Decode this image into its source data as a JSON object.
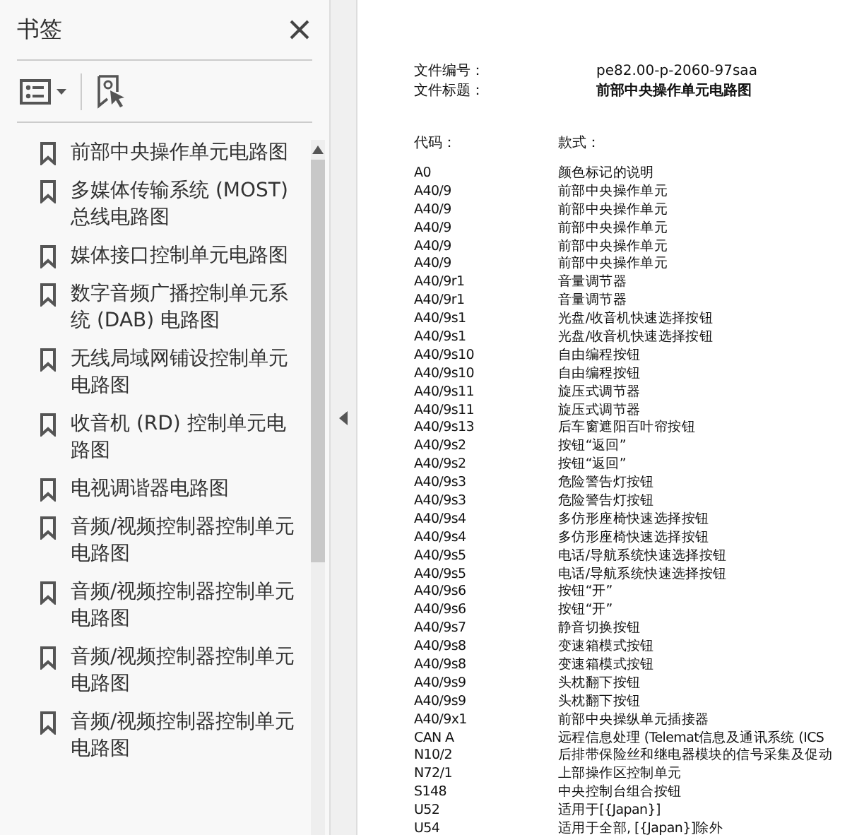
{
  "sidebar": {
    "title": "书签",
    "bookmarks": [
      {
        "label": "前部中央操作单元电路图"
      },
      {
        "label": "多媒体传输系统 (MOST) 总线电路图"
      },
      {
        "label": "媒体接口控制单元电路图"
      },
      {
        "label": "数字音频广播控制单元系统 (DAB) 电路图"
      },
      {
        "label": "无线局域网铺设控制单元电路图"
      },
      {
        "label": "收音机 (RD) 控制单元电路图"
      },
      {
        "label": "电视调谐器电路图"
      },
      {
        "label": "音频/视频控制器控制单元电路图"
      },
      {
        "label": "音频/视频控制器控制单元电路图"
      },
      {
        "label": "音频/视频控制器控制单元电路图"
      },
      {
        "label": "音频/视频控制器控制单元电路图"
      }
    ]
  },
  "document": {
    "meta": [
      {
        "label": "文件编号：",
        "value": "pe82.00-p-2060-97saa"
      },
      {
        "label": "文件标题：",
        "value": "前部中央操作单元电路图"
      }
    ],
    "columns": [
      "代码：",
      "款式："
    ],
    "rows": [
      {
        "code": "A0",
        "description": "颜色标记的说明"
      },
      {
        "code": "A40/9",
        "description": "前部中央操作单元"
      },
      {
        "code": "A40/9",
        "description": "前部中央操作单元"
      },
      {
        "code": "A40/9",
        "description": "前部中央操作单元"
      },
      {
        "code": "A40/9",
        "description": "前部中央操作单元"
      },
      {
        "code": "A40/9",
        "description": "前部中央操作单元"
      },
      {
        "code": "A40/9r1",
        "description": "音量调节器"
      },
      {
        "code": "A40/9r1",
        "description": "音量调节器"
      },
      {
        "code": "A40/9s1",
        "description": "光盘/收音机快速选择按钮"
      },
      {
        "code": "A40/9s1",
        "description": "光盘/收音机快速选择按钮"
      },
      {
        "code": "A40/9s10",
        "description": "自由编程按钮"
      },
      {
        "code": "A40/9s10",
        "description": "自由编程按钮"
      },
      {
        "code": "A40/9s11",
        "description": "旋压式调节器"
      },
      {
        "code": "A40/9s11",
        "description": "旋压式调节器"
      },
      {
        "code": "A40/9s13",
        "description": "后车窗遮阳百叶帘按钮"
      },
      {
        "code": "A40/9s2",
        "description": "按钮“返回”"
      },
      {
        "code": "A40/9s2",
        "description": "按钮“返回”"
      },
      {
        "code": "A40/9s3",
        "description": "危险警告灯按钮"
      },
      {
        "code": "A40/9s3",
        "description": "危险警告灯按钮"
      },
      {
        "code": "A40/9s4",
        "description": "多仿形座椅快速选择按钮"
      },
      {
        "code": "A40/9s4",
        "description": "多仿形座椅快速选择按钮"
      },
      {
        "code": "A40/9s5",
        "description": "电话/导航系统快速选择按钮"
      },
      {
        "code": "A40/9s5",
        "description": "电话/导航系统快速选择按钮"
      },
      {
        "code": "A40/9s6",
        "description": "按钮“开”"
      },
      {
        "code": "A40/9s6",
        "description": "按钮“开”"
      },
      {
        "code": "A40/9s7",
        "description": "静音切换按钮"
      },
      {
        "code": "A40/9s8",
        "description": "变速箱模式按钮"
      },
      {
        "code": "A40/9s8",
        "description": "变速箱模式按钮"
      },
      {
        "code": "A40/9s9",
        "description": "头枕翻下按钮"
      },
      {
        "code": "A40/9s9",
        "description": "头枕翻下按钮"
      },
      {
        "code": "A40/9x1",
        "description": "前部中央操纵单元插接器"
      },
      {
        "code": "CAN A",
        "description": "远程信息处理 (Telemat信息及通讯系统 (ICS"
      },
      {
        "code": "N10/2",
        "description": "后排带保险丝和继电器模块的信号采集及促动"
      },
      {
        "code": "N72/1",
        "description": "上部操作区控制单元"
      },
      {
        "code": "S148",
        "description": "中央控制台组合按钮"
      },
      {
        "code": "U52",
        "description": "适用于[{Japan}]"
      },
      {
        "code": "U54",
        "description": "适用于全部, [{Japan}]除外"
      }
    ]
  }
}
